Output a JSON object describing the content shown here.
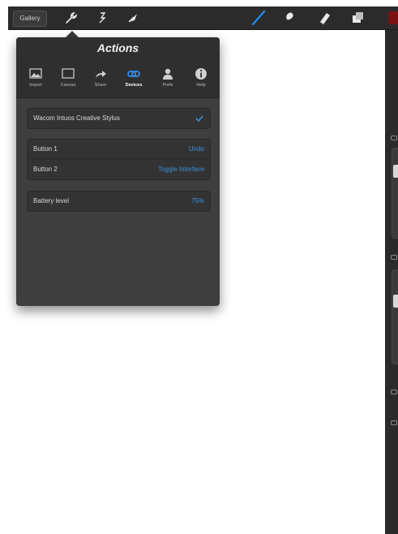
{
  "toolbar": {
    "gallery_label": "Gallery",
    "tools": [
      "wrench-icon",
      "adjust-icon",
      "selection-icon",
      "brush-icon",
      "smudge-icon",
      "eraser-icon",
      "layers-icon"
    ],
    "active_brush_color": "#1e90ff",
    "current_color": "#7a1212"
  },
  "actions": {
    "title": "Actions",
    "tabs": [
      {
        "label": "Import",
        "icon": "image-icon"
      },
      {
        "label": "Canvas",
        "icon": "canvas-icon"
      },
      {
        "label": "Share",
        "icon": "share-icon"
      },
      {
        "label": "Devices",
        "icon": "link-icon",
        "active": true
      },
      {
        "label": "Prefs",
        "icon": "person-icon"
      },
      {
        "label": "Help",
        "icon": "info-icon"
      }
    ],
    "device": {
      "label": "Wacom Intuos Creative Stylus",
      "checked": true
    },
    "buttons": [
      {
        "label": "Button 1",
        "value": "Undo"
      },
      {
        "label": "Button 2",
        "value": "Toggle Interface"
      }
    ],
    "battery": {
      "label": "Battery level",
      "value": "75%"
    }
  },
  "colors": {
    "accent": "#3b8fdc",
    "panel": "#3e3e3e"
  }
}
